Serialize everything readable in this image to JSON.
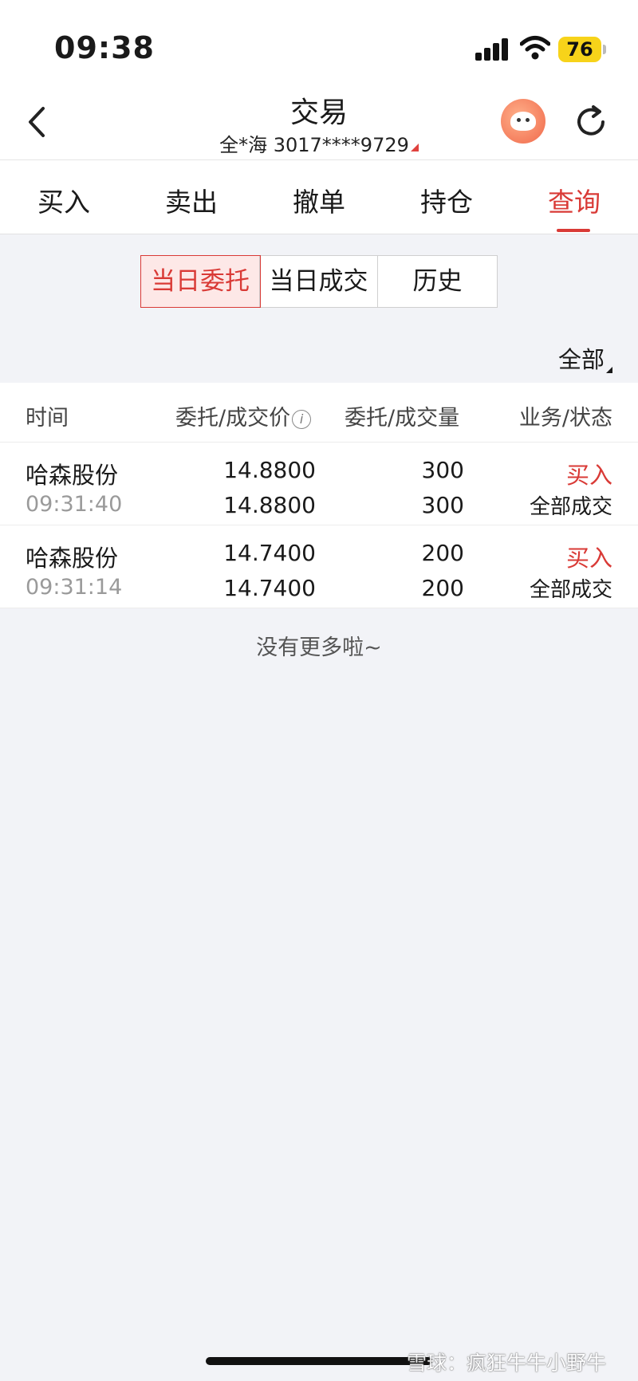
{
  "status_bar": {
    "time": "09:38",
    "battery": "76"
  },
  "nav": {
    "title": "交易",
    "account": "全*海 3017****9729"
  },
  "tabs": [
    {
      "label": "买入",
      "active": false
    },
    {
      "label": "卖出",
      "active": false
    },
    {
      "label": "撤单",
      "active": false
    },
    {
      "label": "持仓",
      "active": false
    },
    {
      "label": "查询",
      "active": true
    }
  ],
  "segments": [
    {
      "label": "当日委托",
      "active": true
    },
    {
      "label": "当日成交",
      "active": false
    },
    {
      "label": "历史",
      "active": false
    }
  ],
  "filter": {
    "label": "全部"
  },
  "table": {
    "headers": {
      "time": "时间",
      "price": "委托/成交价",
      "qty": "委托/成交量",
      "status": "业务/状态"
    },
    "rows": [
      {
        "name": "哈森股份",
        "time": "09:31:40",
        "order_price": "14.8800",
        "deal_price": "14.8800",
        "order_qty": "300",
        "deal_qty": "300",
        "biz": "买入",
        "state": "全部成交"
      },
      {
        "name": "哈森股份",
        "time": "09:31:14",
        "order_price": "14.7400",
        "deal_price": "14.7400",
        "order_qty": "200",
        "deal_qty": "200",
        "biz": "买入",
        "state": "全部成交"
      }
    ]
  },
  "no_more": "没有更多啦~",
  "watermark": "雪球：疯狂牛牛小野牛",
  "colors": {
    "accent": "#d93a36",
    "background": "#f2f3f7",
    "battery": "#f7d31a"
  }
}
